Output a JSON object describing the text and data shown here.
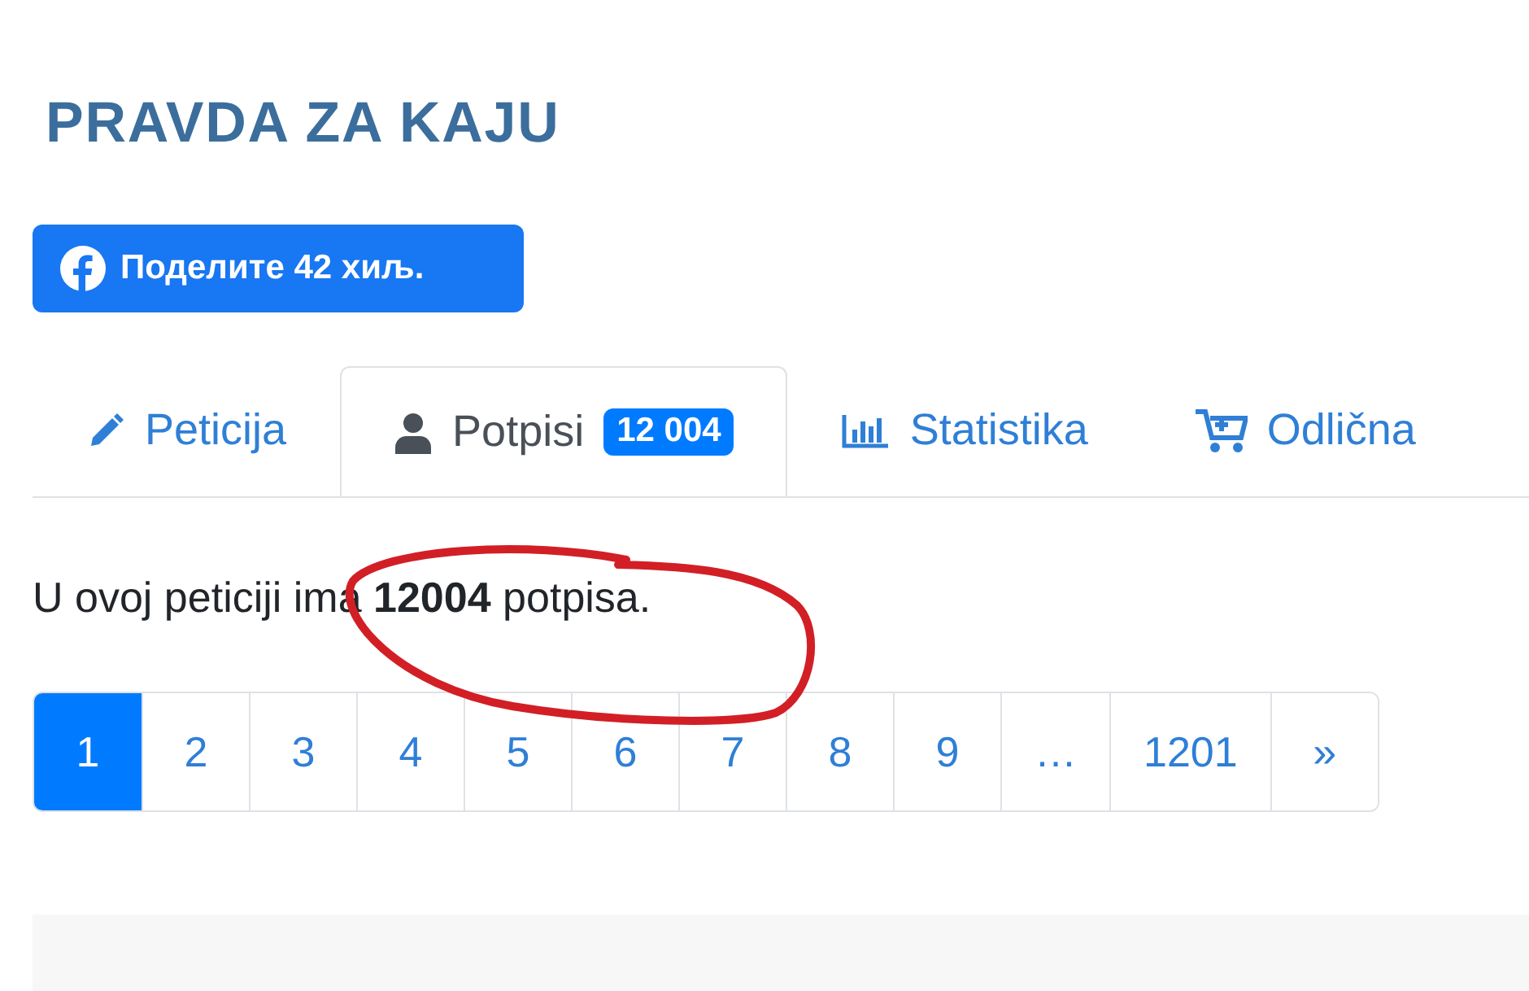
{
  "title": "PRAVDA ZA KAJU",
  "share_button": {
    "label": "Поделите 42 хиљ."
  },
  "tabs": [
    {
      "kind": "pencil",
      "label": "Peticija",
      "selected": false
    },
    {
      "kind": "user",
      "label": "Potpisi",
      "badge": "12 004",
      "selected": true
    },
    {
      "kind": "chart",
      "label": "Statistika",
      "selected": false
    },
    {
      "kind": "cart",
      "label": "Odlična",
      "selected": false
    }
  ],
  "summary": "U ovoj peticiji ima **12004** potpisa.",
  "pagination": [
    {
      "label": "1",
      "selected": true
    },
    {
      "label": "2",
      "selected": false
    },
    {
      "label": "3",
      "selected": false
    },
    {
      "label": "4",
      "selected": false
    },
    {
      "label": "5",
      "selected": false
    },
    {
      "label": "6",
      "selected": false
    },
    {
      "label": "7",
      "selected": false
    },
    {
      "label": "8",
      "selected": false
    },
    {
      "label": "9",
      "selected": false
    },
    {
      "label": "…",
      "selected": false
    },
    {
      "label": "1201",
      "selected": false
    },
    {
      "label": "»",
      "selected": false
    }
  ]
}
